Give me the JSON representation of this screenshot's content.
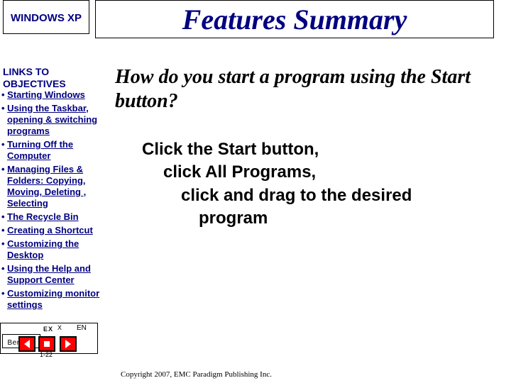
{
  "sidebar": {
    "title": "WINDOWS XP",
    "heading": "LINKS TO OBJECTIVES",
    "items": [
      {
        "label": "Starting Windows"
      },
      {
        "label": "Using the Taskbar, opening & switching programs"
      },
      {
        "label": "Turning Off the Computer"
      },
      {
        "label": "Managing Files & Folders: Copying, Moving, Deleting , Selecting"
      },
      {
        "label": "The Recycle Bin"
      },
      {
        "label": "Creating a Shortcut"
      },
      {
        "label": "Customizing the Desktop"
      },
      {
        "label": "Using the Help and Support Center"
      },
      {
        "label": "Customizing monitor settings"
      }
    ]
  },
  "title": "Features Summary",
  "question": "How do you start a program using the Start button?",
  "answer": {
    "l1": "Click the Start button,",
    "l2": "click All Programs,",
    "l3": "click and drag to the desired",
    "l4": "program"
  },
  "bottombar": {
    "btn": "Ben乇rc",
    "text": "EX",
    "en": "EN",
    "x": "X"
  },
  "slidenum": "1-22",
  "copyright": "Copyright 2007, EMC Paradigm Publishing Inc."
}
